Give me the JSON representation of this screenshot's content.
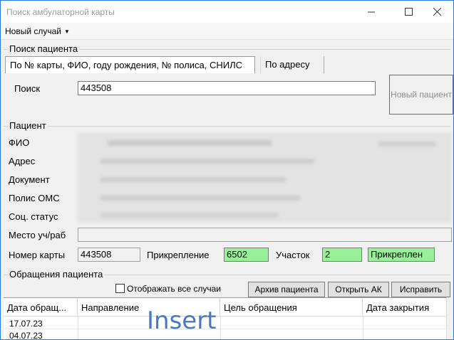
{
  "window": {
    "title": "Поиск амбулаторной карты"
  },
  "menu": {
    "new_case": "Новый случай"
  },
  "search_section": {
    "label": "Поиск пациента",
    "tabs": [
      {
        "label": "По № карты, ФИО, году рождения, № полиса, СНИЛС",
        "active": true
      },
      {
        "label": "По адресу",
        "active": false
      }
    ],
    "search_label": "Поиск",
    "search_value": "443508",
    "new_patient_label": "Новый пациент"
  },
  "patient_section": {
    "label": "Пациент",
    "fio_label": "ФИО",
    "address_label": "Адрес",
    "document_label": "Документ",
    "policy_label": "Полис ОМС",
    "social_label": "Соц. статус",
    "place_label": "Место уч/раб",
    "card_label": "Номер карты",
    "card_value": "443508",
    "attach_label": "Прикрепление",
    "attach_value": "6502",
    "area_label": "Участок",
    "area_value": "2",
    "status_value": "Прикреплен"
  },
  "visits_section": {
    "label": "Обращения пациента",
    "show_all_label": "Отображать все случаи",
    "show_all_checked": false,
    "archive_button": "Архив пациента",
    "open_button": "Открыть АК",
    "fix_button": "Исправить"
  },
  "table": {
    "columns": [
      "Дата обращ...",
      "Направление",
      "Цель обращения",
      "Дата закрытия"
    ],
    "rows": [
      {
        "date": "17.07.23"
      },
      {
        "date": "04.07.23"
      }
    ]
  },
  "overlay": {
    "text": "Insert"
  },
  "colors": {
    "window_border": "#2b79d6",
    "green_field": "#98f098",
    "watermark": "#4a78c8"
  }
}
